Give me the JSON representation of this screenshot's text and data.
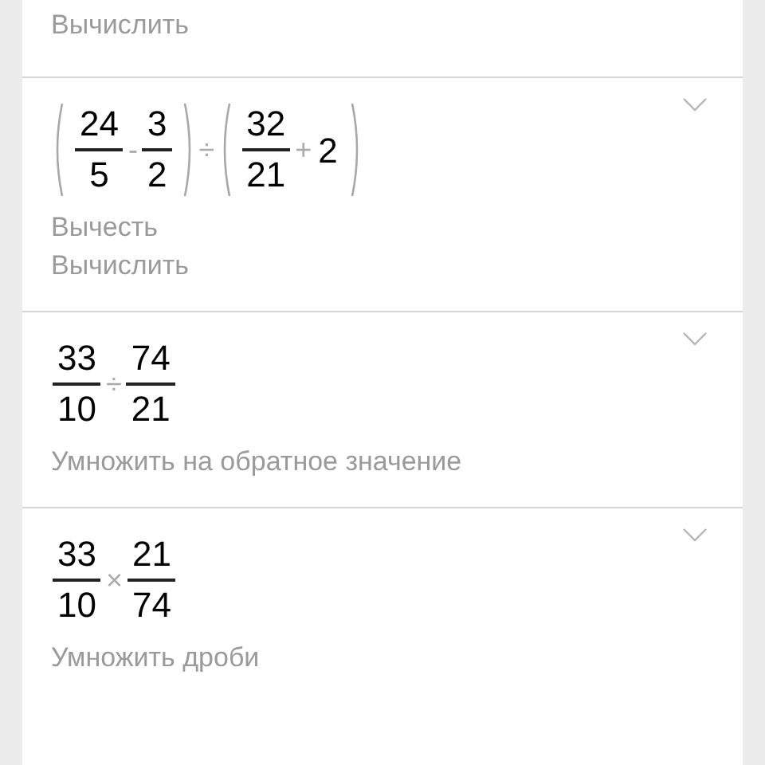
{
  "steps": [
    {
      "notes": [
        "Вычислить"
      ]
    },
    {
      "expression": [
        {
          "kind": "paren",
          "items": [
            {
              "kind": "fraction",
              "num": "24",
              "den": "5"
            },
            {
              "kind": "op",
              "text": "-"
            },
            {
              "kind": "fraction",
              "num": "3",
              "den": "2"
            }
          ]
        },
        {
          "kind": "op",
          "text": "÷"
        },
        {
          "kind": "paren",
          "items": [
            {
              "kind": "fraction",
              "num": "32",
              "den": "21"
            },
            {
              "kind": "op",
              "text": "+"
            },
            {
              "kind": "number",
              "text": "2"
            }
          ]
        }
      ],
      "collapsed": true,
      "notes": [
        "Вычесть",
        "Вычислить"
      ]
    },
    {
      "expression": [
        {
          "kind": "fraction",
          "num": "33",
          "den": "10"
        },
        {
          "kind": "op",
          "text": "÷"
        },
        {
          "kind": "fraction",
          "num": "74",
          "den": "21"
        }
      ],
      "collapsed": true,
      "notes": [
        "Умножить на обратное значение"
      ]
    },
    {
      "expression": [
        {
          "kind": "fraction",
          "num": "33",
          "den": "10"
        },
        {
          "kind": "op",
          "text": "×"
        },
        {
          "kind": "fraction",
          "num": "21",
          "den": "74"
        }
      ],
      "collapsed": true,
      "notes": [
        "Умножить дроби"
      ]
    }
  ]
}
